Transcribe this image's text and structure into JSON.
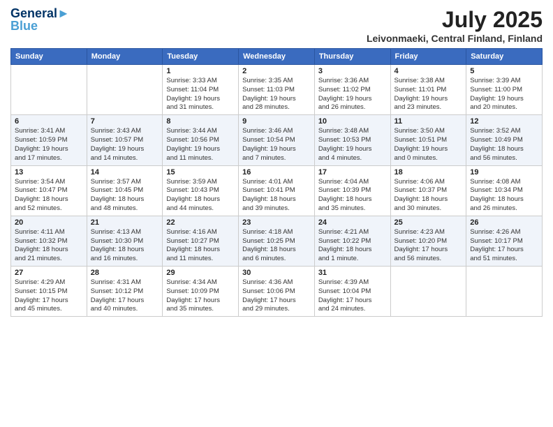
{
  "header": {
    "logo_line1": "General",
    "logo_line2": "Blue",
    "month": "July 2025",
    "location": "Leivonmaeki, Central Finland, Finland"
  },
  "weekdays": [
    "Sunday",
    "Monday",
    "Tuesday",
    "Wednesday",
    "Thursday",
    "Friday",
    "Saturday"
  ],
  "weeks": [
    [
      {
        "day": "",
        "info": ""
      },
      {
        "day": "",
        "info": ""
      },
      {
        "day": "1",
        "info": "Sunrise: 3:33 AM\nSunset: 11:04 PM\nDaylight: 19 hours\nand 31 minutes."
      },
      {
        "day": "2",
        "info": "Sunrise: 3:35 AM\nSunset: 11:03 PM\nDaylight: 19 hours\nand 28 minutes."
      },
      {
        "day": "3",
        "info": "Sunrise: 3:36 AM\nSunset: 11:02 PM\nDaylight: 19 hours\nand 26 minutes."
      },
      {
        "day": "4",
        "info": "Sunrise: 3:38 AM\nSunset: 11:01 PM\nDaylight: 19 hours\nand 23 minutes."
      },
      {
        "day": "5",
        "info": "Sunrise: 3:39 AM\nSunset: 11:00 PM\nDaylight: 19 hours\nand 20 minutes."
      }
    ],
    [
      {
        "day": "6",
        "info": "Sunrise: 3:41 AM\nSunset: 10:59 PM\nDaylight: 19 hours\nand 17 minutes."
      },
      {
        "day": "7",
        "info": "Sunrise: 3:43 AM\nSunset: 10:57 PM\nDaylight: 19 hours\nand 14 minutes."
      },
      {
        "day": "8",
        "info": "Sunrise: 3:44 AM\nSunset: 10:56 PM\nDaylight: 19 hours\nand 11 minutes."
      },
      {
        "day": "9",
        "info": "Sunrise: 3:46 AM\nSunset: 10:54 PM\nDaylight: 19 hours\nand 7 minutes."
      },
      {
        "day": "10",
        "info": "Sunrise: 3:48 AM\nSunset: 10:53 PM\nDaylight: 19 hours\nand 4 minutes."
      },
      {
        "day": "11",
        "info": "Sunrise: 3:50 AM\nSunset: 10:51 PM\nDaylight: 19 hours\nand 0 minutes."
      },
      {
        "day": "12",
        "info": "Sunrise: 3:52 AM\nSunset: 10:49 PM\nDaylight: 18 hours\nand 56 minutes."
      }
    ],
    [
      {
        "day": "13",
        "info": "Sunrise: 3:54 AM\nSunset: 10:47 PM\nDaylight: 18 hours\nand 52 minutes."
      },
      {
        "day": "14",
        "info": "Sunrise: 3:57 AM\nSunset: 10:45 PM\nDaylight: 18 hours\nand 48 minutes."
      },
      {
        "day": "15",
        "info": "Sunrise: 3:59 AM\nSunset: 10:43 PM\nDaylight: 18 hours\nand 44 minutes."
      },
      {
        "day": "16",
        "info": "Sunrise: 4:01 AM\nSunset: 10:41 PM\nDaylight: 18 hours\nand 39 minutes."
      },
      {
        "day": "17",
        "info": "Sunrise: 4:04 AM\nSunset: 10:39 PM\nDaylight: 18 hours\nand 35 minutes."
      },
      {
        "day": "18",
        "info": "Sunrise: 4:06 AM\nSunset: 10:37 PM\nDaylight: 18 hours\nand 30 minutes."
      },
      {
        "day": "19",
        "info": "Sunrise: 4:08 AM\nSunset: 10:34 PM\nDaylight: 18 hours\nand 26 minutes."
      }
    ],
    [
      {
        "day": "20",
        "info": "Sunrise: 4:11 AM\nSunset: 10:32 PM\nDaylight: 18 hours\nand 21 minutes."
      },
      {
        "day": "21",
        "info": "Sunrise: 4:13 AM\nSunset: 10:30 PM\nDaylight: 18 hours\nand 16 minutes."
      },
      {
        "day": "22",
        "info": "Sunrise: 4:16 AM\nSunset: 10:27 PM\nDaylight: 18 hours\nand 11 minutes."
      },
      {
        "day": "23",
        "info": "Sunrise: 4:18 AM\nSunset: 10:25 PM\nDaylight: 18 hours\nand 6 minutes."
      },
      {
        "day": "24",
        "info": "Sunrise: 4:21 AM\nSunset: 10:22 PM\nDaylight: 18 hours\nand 1 minute."
      },
      {
        "day": "25",
        "info": "Sunrise: 4:23 AM\nSunset: 10:20 PM\nDaylight: 17 hours\nand 56 minutes."
      },
      {
        "day": "26",
        "info": "Sunrise: 4:26 AM\nSunset: 10:17 PM\nDaylight: 17 hours\nand 51 minutes."
      }
    ],
    [
      {
        "day": "27",
        "info": "Sunrise: 4:29 AM\nSunset: 10:15 PM\nDaylight: 17 hours\nand 45 minutes."
      },
      {
        "day": "28",
        "info": "Sunrise: 4:31 AM\nSunset: 10:12 PM\nDaylight: 17 hours\nand 40 minutes."
      },
      {
        "day": "29",
        "info": "Sunrise: 4:34 AM\nSunset: 10:09 PM\nDaylight: 17 hours\nand 35 minutes."
      },
      {
        "day": "30",
        "info": "Sunrise: 4:36 AM\nSunset: 10:06 PM\nDaylight: 17 hours\nand 29 minutes."
      },
      {
        "day": "31",
        "info": "Sunrise: 4:39 AM\nSunset: 10:04 PM\nDaylight: 17 hours\nand 24 minutes."
      },
      {
        "day": "",
        "info": ""
      },
      {
        "day": "",
        "info": ""
      }
    ]
  ]
}
